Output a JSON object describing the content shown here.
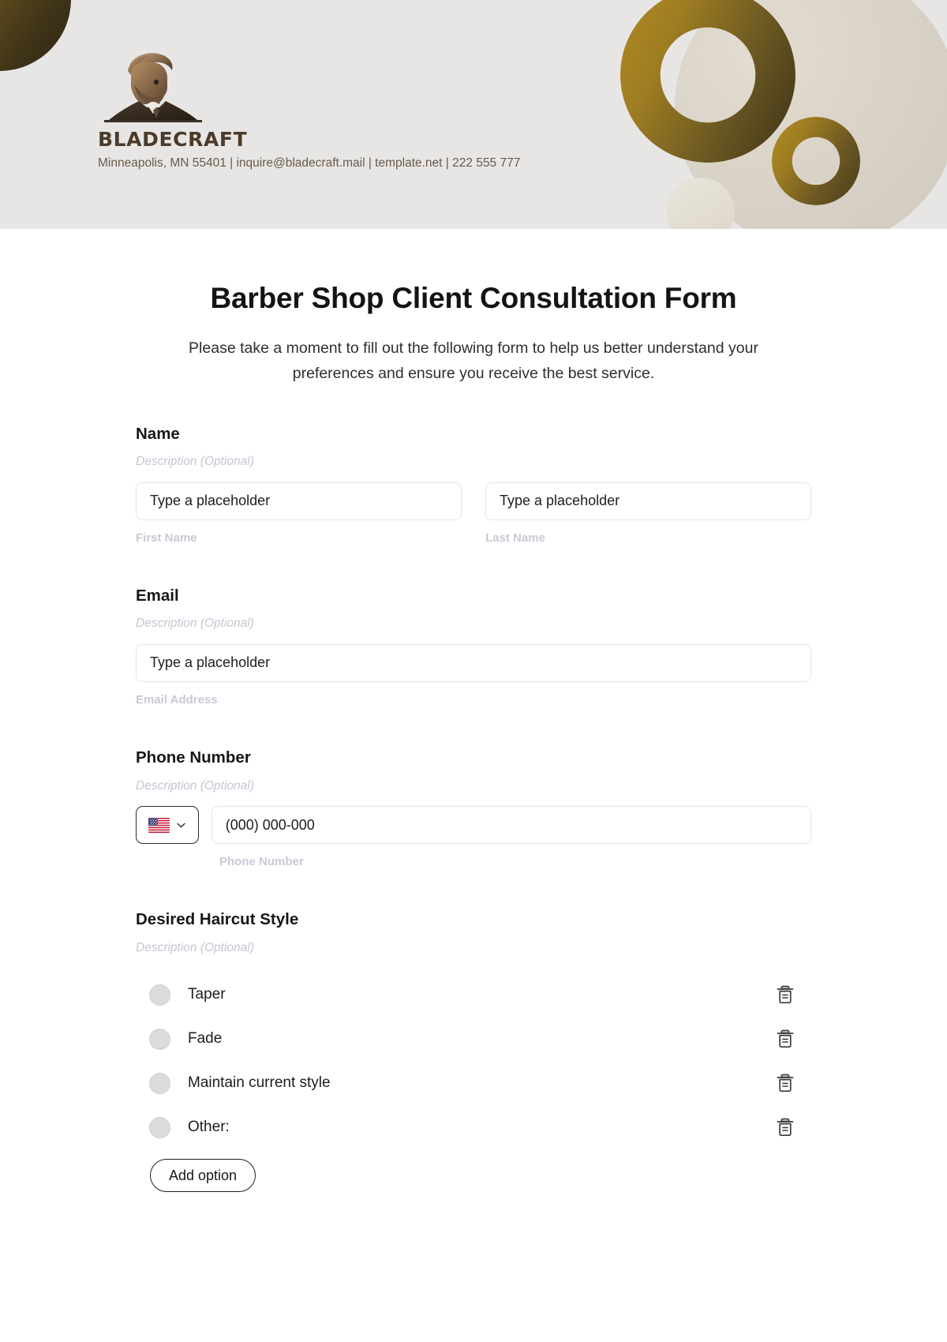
{
  "header": {
    "brand_name": "BLADECRAFT",
    "contact_line": "Minneapolis, MN 55401 | inquire@bladecraft.mail | template.net | 222 555 777",
    "logo_alt": "barber-bust-logo",
    "colors": {
      "band_background": "#e7e6e5",
      "gold_light": "#b08a23",
      "gold_dark": "#3d3218",
      "beige": "#d8d2c6",
      "brand_text": "#4b3a2a",
      "contact_text": "#6b5a4b"
    }
  },
  "form": {
    "title": "Barber Shop Client Consultation Form",
    "subtitle": "Please take a moment to fill out the following form to help us better understand your preferences and ensure you receive the best service.",
    "fields": [
      {
        "label": "Name",
        "description": "Description (Optional)",
        "type": "name",
        "inputs": [
          {
            "placeholder": "Type a placeholder",
            "sub_label": "First Name"
          },
          {
            "placeholder": "Type a placeholder",
            "sub_label": "Last Name"
          }
        ]
      },
      {
        "label": "Email",
        "description": "Description (Optional)",
        "type": "email",
        "inputs": [
          {
            "placeholder": "Type a placeholder",
            "sub_label": "Email Address"
          }
        ]
      },
      {
        "label": "Phone Number",
        "description": "Description (Optional)",
        "type": "phone",
        "country_flag": "us-flag-icon",
        "inputs": [
          {
            "placeholder": "(000) 000-000",
            "sub_label": "Phone Number"
          }
        ]
      },
      {
        "label": "Desired Haircut Style",
        "description": "Description (Optional)",
        "type": "radio",
        "options": [
          {
            "label": "Taper"
          },
          {
            "label": "Fade"
          },
          {
            "label": "Maintain current style"
          },
          {
            "label": "Other:"
          }
        ],
        "add_option_label": "Add option"
      }
    ]
  }
}
